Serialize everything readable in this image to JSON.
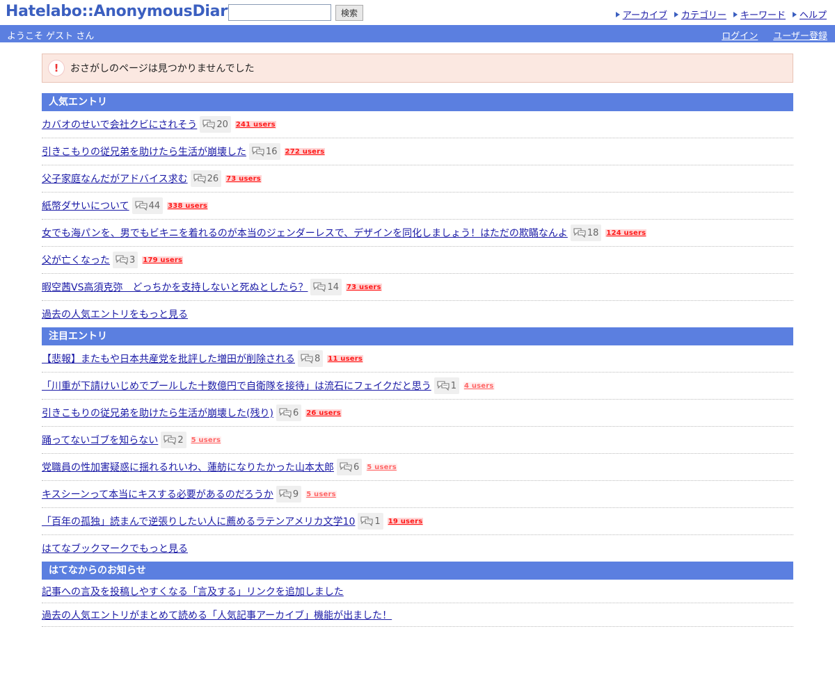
{
  "header": {
    "logo": "Hatelabo::AnonymousDiary",
    "search_placeholder": "",
    "search_button": "検索",
    "nav": [
      "アーカイブ",
      "カテゴリー",
      "キーワード",
      "ヘルプ"
    ]
  },
  "userbar": {
    "welcome": "ようこそ ゲスト さん",
    "login": "ログイン",
    "register": "ユーザー登録"
  },
  "alert": {
    "icon": "!",
    "message": "おさがしのページは見つかりませんでした"
  },
  "popular": {
    "title": "人気エントリ",
    "entries": [
      {
        "title": "カバオのせいで会社クビにされそう",
        "comments": "20",
        "users": "241 users"
      },
      {
        "title": "引きこもりの従兄弟を助けたら生活が崩壊した",
        "comments": "16",
        "users": "272 users"
      },
      {
        "title": "父子家庭なんだがアドバイス求む",
        "comments": "26",
        "users": "73 users"
      },
      {
        "title": "紙幣ダサいについて",
        "comments": "44",
        "users": "338 users"
      },
      {
        "title": "女でも海パンを、男でもビキニを着れるのが本当のジェンダーレスで、デザインを同化しましょう！はただの欺瞞なんよ",
        "comments": "18",
        "users": "124 users"
      },
      {
        "title": "父が亡くなった",
        "comments": "3",
        "users": "179 users"
      },
      {
        "title": "暇空茜VS高須克弥　どっちかを支持しないと死ぬとしたら？",
        "comments": "14",
        "users": "73 users"
      }
    ],
    "more": "過去の人気エントリをもっと見る"
  },
  "featured": {
    "title": "注目エントリ",
    "entries": [
      {
        "title": "【悲報】またもや日本共産党を批評した増田が削除される",
        "comments": "8",
        "users": "11 users"
      },
      {
        "title": "「川重が下請けいじめでプールした十数億円で自衛隊を接待」は流石にフェイクだと思う",
        "comments": "1",
        "users": "4 users"
      },
      {
        "title": "引きこもりの従兄弟を助けたら生活が崩壊した(残り)",
        "comments": "6",
        "users": "26 users"
      },
      {
        "title": "踊ってないゴブを知らない",
        "comments": "2",
        "users": "5 users"
      },
      {
        "title": "党職員の性加害疑惑に揺れるれいわ、蓮舫になりたかった山本太郎",
        "comments": "6",
        "users": "5 users"
      },
      {
        "title": "キスシーンって本当にキスする必要があるのだろうか",
        "comments": "9",
        "users": "5 users"
      },
      {
        "title": "「百年の孤独」読まんで逆張りしたい人に薦めるラテンアメリカ文学10",
        "comments": "1",
        "users": "19 users"
      }
    ],
    "more": "はてなブックマークでもっと見る"
  },
  "news": {
    "title": "はてなからのお知らせ",
    "items": [
      "記事への言及を投稿しやすくなる「言及する」リンクを追加しました",
      "過去の人気エントリがまとめて読める「人気記事アーカイブ」機能が出ました！"
    ]
  },
  "colors": {
    "accent": "#5b7fe0",
    "link": "#1a1aa6",
    "users_hot": "#ff1a1a",
    "users_warm": "#ff6666",
    "alert_bg": "#fbe8e1"
  },
  "icons": {
    "comment": "comment-bubble-icon",
    "alert": "exclamation-icon",
    "nav_arrow": "triangle-right-icon"
  }
}
